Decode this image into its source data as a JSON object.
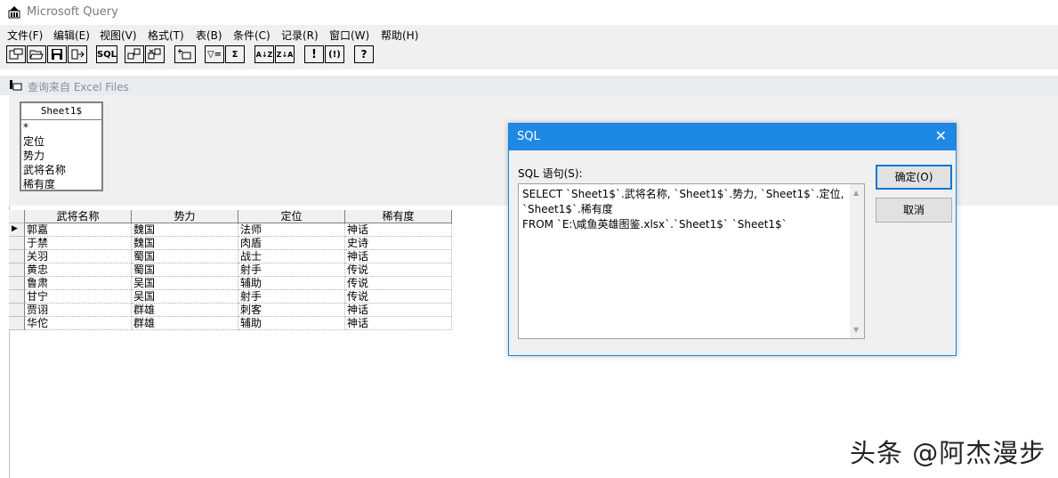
{
  "app": {
    "title": "Microsoft Query"
  },
  "menu": [
    "文件(F)",
    "编辑(E)",
    "视图(V)",
    "格式(T)",
    "表(B)",
    "条件(C)",
    "记录(R)",
    "窗口(W)",
    "帮助(H)"
  ],
  "toolbar": {
    "sql_label": "SQL",
    "filter_label": "▽=",
    "sum_label": "Σ",
    "sort_asc_label": "A↓Z",
    "sort_desc_label": "Z↓A",
    "query_now_label": "!",
    "auto_query_label": "(!)",
    "help_label": "?"
  },
  "query_window": {
    "title": "查询来自 Excel Files"
  },
  "table_box": {
    "name": "Sheet1$",
    "fields": [
      "*",
      "定位",
      "势力",
      "武将名称",
      "稀有度"
    ]
  },
  "grid": {
    "columns": [
      "武将名称",
      "势力",
      "定位",
      "稀有度"
    ],
    "rows": [
      [
        "郭嘉",
        "魏国",
        "法师",
        "神话"
      ],
      [
        "于禁",
        "魏国",
        "肉盾",
        "史诗"
      ],
      [
        "关羽",
        "蜀国",
        "战士",
        "神话"
      ],
      [
        "黄忠",
        "蜀国",
        "射手",
        "传说"
      ],
      [
        "鲁肃",
        "吴国",
        "辅助",
        "传说"
      ],
      [
        "甘宁",
        "吴国",
        "射手",
        "传说"
      ],
      [
        "贾诩",
        "群雄",
        "刺客",
        "神话"
      ],
      [
        "华佗",
        "群雄",
        "辅助",
        "神话"
      ]
    ]
  },
  "sql_dialog": {
    "title": "SQL",
    "label": "SQL 语句(S):",
    "sql": "SELECT `Sheet1$`.武将名称, `Sheet1$`.势力, `Sheet1$`.定位, `Sheet1$`.稀有度\nFROM `E:\\咸鱼英雄图鉴.xlsx`.`Sheet1$` `Sheet1$`",
    "ok": "确定(O)",
    "cancel": "取消"
  },
  "watermark": "头条 @阿杰漫步"
}
